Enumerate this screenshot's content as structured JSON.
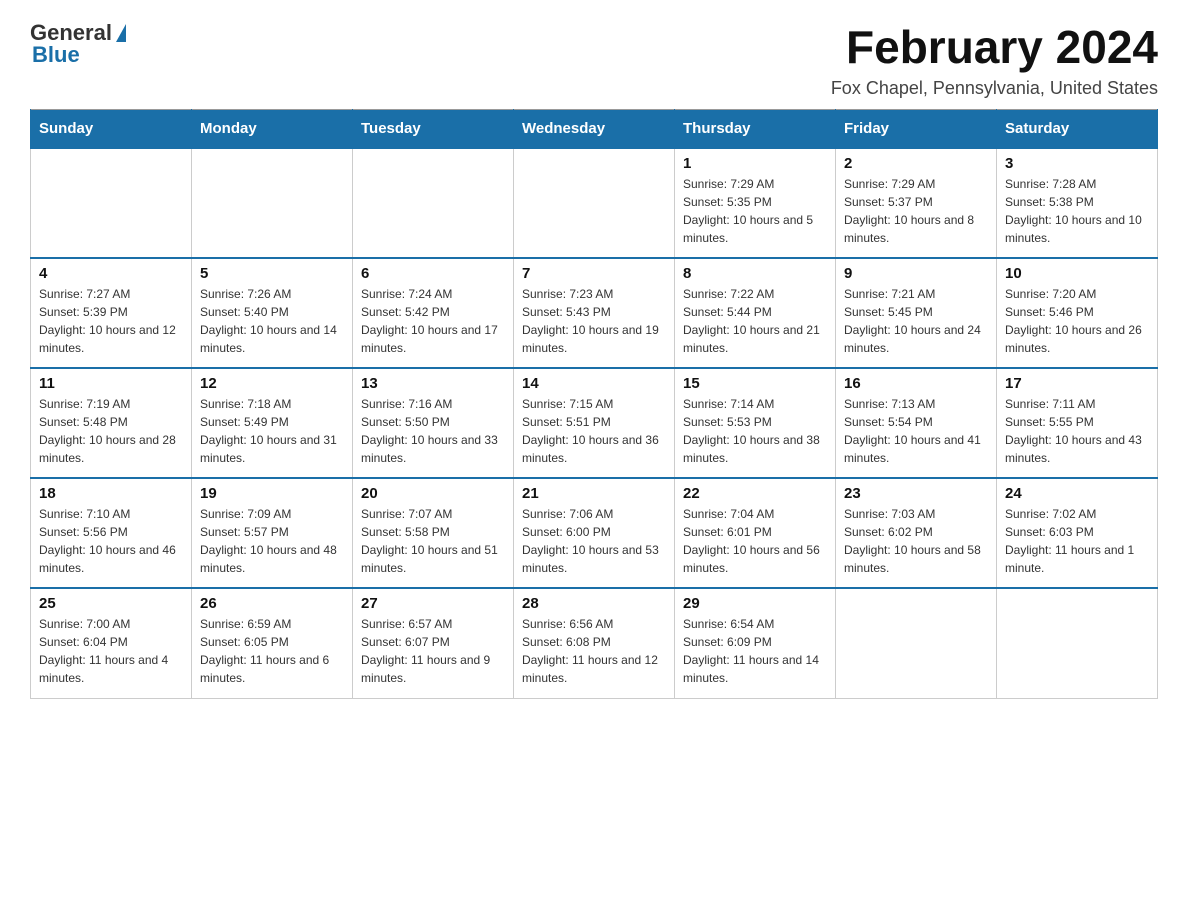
{
  "header": {
    "logo_text_general": "General",
    "logo_text_blue": "Blue",
    "month_title": "February 2024",
    "location": "Fox Chapel, Pennsylvania, United States"
  },
  "days_of_week": [
    "Sunday",
    "Monday",
    "Tuesday",
    "Wednesday",
    "Thursday",
    "Friday",
    "Saturday"
  ],
  "weeks": [
    {
      "days": [
        {
          "num": "",
          "info": ""
        },
        {
          "num": "",
          "info": ""
        },
        {
          "num": "",
          "info": ""
        },
        {
          "num": "",
          "info": ""
        },
        {
          "num": "1",
          "info": "Sunrise: 7:29 AM\nSunset: 5:35 PM\nDaylight: 10 hours and 5 minutes."
        },
        {
          "num": "2",
          "info": "Sunrise: 7:29 AM\nSunset: 5:37 PM\nDaylight: 10 hours and 8 minutes."
        },
        {
          "num": "3",
          "info": "Sunrise: 7:28 AM\nSunset: 5:38 PM\nDaylight: 10 hours and 10 minutes."
        }
      ]
    },
    {
      "days": [
        {
          "num": "4",
          "info": "Sunrise: 7:27 AM\nSunset: 5:39 PM\nDaylight: 10 hours and 12 minutes."
        },
        {
          "num": "5",
          "info": "Sunrise: 7:26 AM\nSunset: 5:40 PM\nDaylight: 10 hours and 14 minutes."
        },
        {
          "num": "6",
          "info": "Sunrise: 7:24 AM\nSunset: 5:42 PM\nDaylight: 10 hours and 17 minutes."
        },
        {
          "num": "7",
          "info": "Sunrise: 7:23 AM\nSunset: 5:43 PM\nDaylight: 10 hours and 19 minutes."
        },
        {
          "num": "8",
          "info": "Sunrise: 7:22 AM\nSunset: 5:44 PM\nDaylight: 10 hours and 21 minutes."
        },
        {
          "num": "9",
          "info": "Sunrise: 7:21 AM\nSunset: 5:45 PM\nDaylight: 10 hours and 24 minutes."
        },
        {
          "num": "10",
          "info": "Sunrise: 7:20 AM\nSunset: 5:46 PM\nDaylight: 10 hours and 26 minutes."
        }
      ]
    },
    {
      "days": [
        {
          "num": "11",
          "info": "Sunrise: 7:19 AM\nSunset: 5:48 PM\nDaylight: 10 hours and 28 minutes."
        },
        {
          "num": "12",
          "info": "Sunrise: 7:18 AM\nSunset: 5:49 PM\nDaylight: 10 hours and 31 minutes."
        },
        {
          "num": "13",
          "info": "Sunrise: 7:16 AM\nSunset: 5:50 PM\nDaylight: 10 hours and 33 minutes."
        },
        {
          "num": "14",
          "info": "Sunrise: 7:15 AM\nSunset: 5:51 PM\nDaylight: 10 hours and 36 minutes."
        },
        {
          "num": "15",
          "info": "Sunrise: 7:14 AM\nSunset: 5:53 PM\nDaylight: 10 hours and 38 minutes."
        },
        {
          "num": "16",
          "info": "Sunrise: 7:13 AM\nSunset: 5:54 PM\nDaylight: 10 hours and 41 minutes."
        },
        {
          "num": "17",
          "info": "Sunrise: 7:11 AM\nSunset: 5:55 PM\nDaylight: 10 hours and 43 minutes."
        }
      ]
    },
    {
      "days": [
        {
          "num": "18",
          "info": "Sunrise: 7:10 AM\nSunset: 5:56 PM\nDaylight: 10 hours and 46 minutes."
        },
        {
          "num": "19",
          "info": "Sunrise: 7:09 AM\nSunset: 5:57 PM\nDaylight: 10 hours and 48 minutes."
        },
        {
          "num": "20",
          "info": "Sunrise: 7:07 AM\nSunset: 5:58 PM\nDaylight: 10 hours and 51 minutes."
        },
        {
          "num": "21",
          "info": "Sunrise: 7:06 AM\nSunset: 6:00 PM\nDaylight: 10 hours and 53 minutes."
        },
        {
          "num": "22",
          "info": "Sunrise: 7:04 AM\nSunset: 6:01 PM\nDaylight: 10 hours and 56 minutes."
        },
        {
          "num": "23",
          "info": "Sunrise: 7:03 AM\nSunset: 6:02 PM\nDaylight: 10 hours and 58 minutes."
        },
        {
          "num": "24",
          "info": "Sunrise: 7:02 AM\nSunset: 6:03 PM\nDaylight: 11 hours and 1 minute."
        }
      ]
    },
    {
      "days": [
        {
          "num": "25",
          "info": "Sunrise: 7:00 AM\nSunset: 6:04 PM\nDaylight: 11 hours and 4 minutes."
        },
        {
          "num": "26",
          "info": "Sunrise: 6:59 AM\nSunset: 6:05 PM\nDaylight: 11 hours and 6 minutes."
        },
        {
          "num": "27",
          "info": "Sunrise: 6:57 AM\nSunset: 6:07 PM\nDaylight: 11 hours and 9 minutes."
        },
        {
          "num": "28",
          "info": "Sunrise: 6:56 AM\nSunset: 6:08 PM\nDaylight: 11 hours and 12 minutes."
        },
        {
          "num": "29",
          "info": "Sunrise: 6:54 AM\nSunset: 6:09 PM\nDaylight: 11 hours and 14 minutes."
        },
        {
          "num": "",
          "info": ""
        },
        {
          "num": "",
          "info": ""
        }
      ]
    }
  ]
}
